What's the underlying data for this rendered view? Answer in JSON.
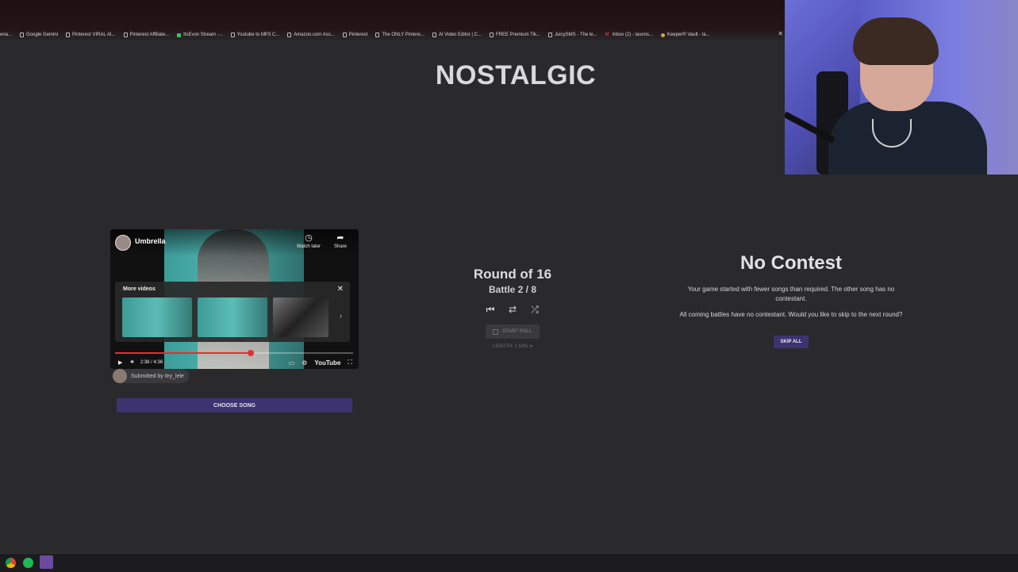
{
  "bookmarks": [
    {
      "label": "ena...",
      "icon": "none"
    },
    {
      "label": "Google Gemini",
      "icon": "page-icon"
    },
    {
      "label": "Pinterest VIRAL AI...",
      "icon": "page-icon"
    },
    {
      "label": "Pinterest Affiliate...",
      "icon": "page-icon"
    },
    {
      "label": "ItsEvon Stream -...",
      "icon": "green-icon"
    },
    {
      "label": "Youtube to MP3 C...",
      "icon": "page-icon"
    },
    {
      "label": "Amazon.com Ass...",
      "icon": "page-icon"
    },
    {
      "label": "Pinterest",
      "icon": "page-icon"
    },
    {
      "label": "The ONLY Pintere...",
      "icon": "page-icon"
    },
    {
      "label": "AI Video Editor | C...",
      "icon": "page-icon"
    },
    {
      "label": "FREE Premium Tik...",
      "icon": "page-icon"
    },
    {
      "label": "JuicySMS - The le...",
      "icon": "page-icon"
    },
    {
      "label": "Inbox (2) - lavons...",
      "icon": "gmail-icon"
    },
    {
      "label": "Keeper® Vault - la...",
      "icon": "keeper-icon"
    }
  ],
  "page_title": "NOSTALGIC",
  "video": {
    "title": "Umbrella",
    "watch_later": "Watch later",
    "share": "Share",
    "more_videos": "More videos",
    "time": "2:38 / 4:36",
    "progress": 0.57,
    "brand": "YouTube"
  },
  "submitted_by": "Submitted by itry_lele",
  "choose_song": "CHOOSE SONG",
  "round": {
    "title": "Round of 16",
    "battle": "Battle 2 / 8",
    "start_poll": "START POLL",
    "length": "LENGTH: 1 MIN. ▾"
  },
  "no_contest": {
    "title": "No Contest",
    "p1": "Your game started with fewer songs than required. The other song has no contestant.",
    "p2": "All coming battles have no contestant. Would you like to skip to the next round?",
    "skip_all": "SKIP ALL"
  },
  "colors": {
    "accent": "#3c3370",
    "background": "#2a292c",
    "progress": "#e03131"
  }
}
